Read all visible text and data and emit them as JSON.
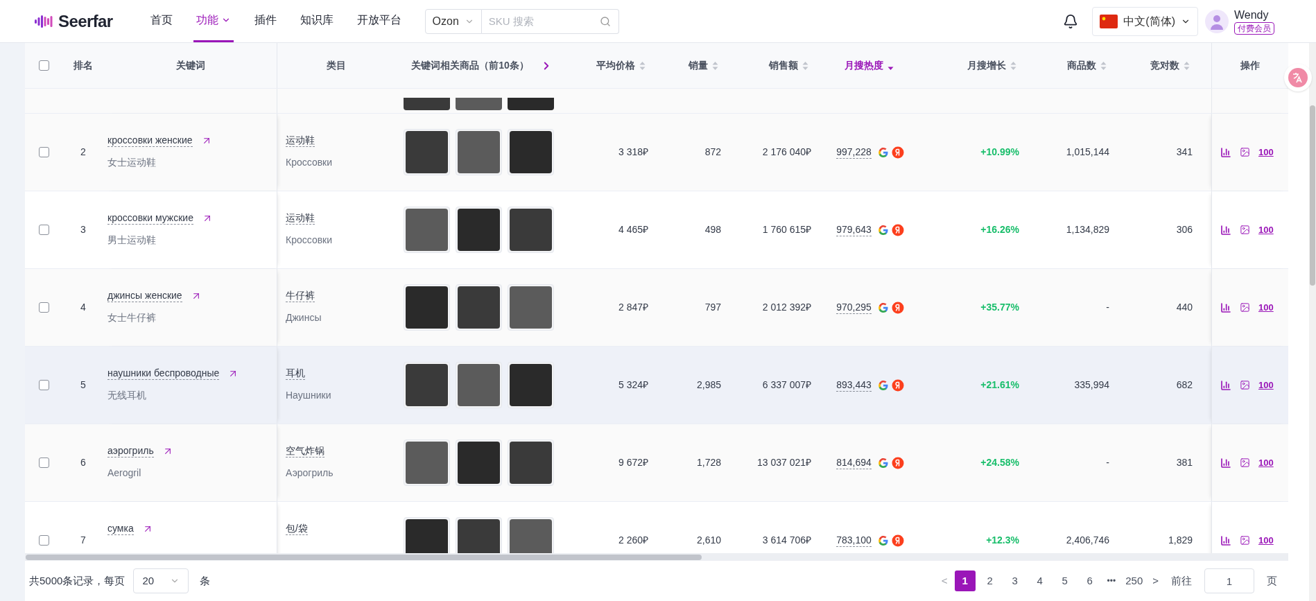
{
  "header": {
    "logo": "Seerfar",
    "nav": [
      {
        "label": "首页",
        "selected": false,
        "dropdown": false
      },
      {
        "label": "功能",
        "selected": true,
        "dropdown": true
      },
      {
        "label": "插件",
        "selected": false,
        "dropdown": false
      },
      {
        "label": "知识库",
        "selected": false,
        "dropdown": false
      },
      {
        "label": "开放平台",
        "selected": false,
        "dropdown": false
      }
    ],
    "platform": "Ozon",
    "search": {
      "placeholder": "SKU 搜索"
    },
    "language": "中文(简体)",
    "user": {
      "name": "Wendy",
      "badge": "付费会员"
    }
  },
  "table": {
    "select_all_checked": false,
    "columns": [
      {
        "label": "排名",
        "sortable": false,
        "sorted_desc": false
      },
      {
        "label": "关键词",
        "sortable": false,
        "sorted_desc": false
      },
      {
        "label": "类目",
        "sortable": false,
        "sorted_desc": false
      },
      {
        "label": "关键词相关商品（前10条）",
        "sortable": false,
        "sorted_desc": false
      },
      {
        "label": "平均价格",
        "sortable": true,
        "sorted_desc": false
      },
      {
        "label": "销量",
        "sortable": true,
        "sorted_desc": false
      },
      {
        "label": "销售额",
        "sortable": true,
        "sorted_desc": false
      },
      {
        "label": "月搜热度",
        "sortable": true,
        "sorted_desc": true
      },
      {
        "label": "月搜增长",
        "sortable": true,
        "sorted_desc": false
      },
      {
        "label": "商品数",
        "sortable": true,
        "sorted_desc": false
      },
      {
        "label": "竞对数",
        "sortable": true,
        "sorted_desc": false
      },
      {
        "label": "操作",
        "sortable": false,
        "sorted_desc": false
      }
    ],
    "rows": [
      {
        "rank": "2",
        "keyword": "кроссовки женские",
        "keyword_zh": "女士运动鞋",
        "category_zh": "运动鞋",
        "category_ru": "Кроссовки",
        "avg_price": "3 318₽",
        "sales": "872",
        "revenue": "2 176 040₽",
        "heat": "997,228",
        "growth": "+10.99%",
        "goods": "1,015,144",
        "competitors": "341",
        "link": "100",
        "checked": false,
        "highlighted": false
      },
      {
        "rank": "3",
        "keyword": "кроссовки мужские",
        "keyword_zh": "男士运动鞋",
        "category_zh": "运动鞋",
        "category_ru": "Кроссовки",
        "avg_price": "4 465₽",
        "sales": "498",
        "revenue": "1 760 615₽",
        "heat": "979,643",
        "growth": "+16.26%",
        "goods": "1,134,829",
        "competitors": "306",
        "link": "100",
        "checked": false,
        "highlighted": false
      },
      {
        "rank": "4",
        "keyword": "джинсы женские",
        "keyword_zh": "女士牛仔裤",
        "category_zh": "牛仔裤",
        "category_ru": "Джинсы",
        "avg_price": "2 847₽",
        "sales": "797",
        "revenue": "2 012 392₽",
        "heat": "970,295",
        "growth": "+35.77%",
        "goods": "-",
        "competitors": "440",
        "link": "100",
        "checked": false,
        "highlighted": false
      },
      {
        "rank": "5",
        "keyword": "наушники беспроводные",
        "keyword_zh": "无线耳机",
        "category_zh": "耳机",
        "category_ru": "Наушники",
        "avg_price": "5 324₽",
        "sales": "2,985",
        "revenue": "6 337 007₽",
        "heat": "893,443",
        "growth": "+21.61%",
        "goods": "335,994",
        "competitors": "682",
        "link": "100",
        "checked": false,
        "highlighted": true
      },
      {
        "rank": "6",
        "keyword": "аэрогриль",
        "keyword_zh": "Aerogril",
        "category_zh": "空气炸锅",
        "category_ru": "Аэрогриль",
        "avg_price": "9 672₽",
        "sales": "1,728",
        "revenue": "13 037 021₽",
        "heat": "814,694",
        "growth": "+24.58%",
        "goods": "-",
        "competitors": "381",
        "link": "100",
        "checked": false,
        "highlighted": false
      },
      {
        "rank": "7",
        "keyword": "сумка",
        "category_zh": "包/袋",
        "avg_price": "2 260₽",
        "sales": "2,610",
        "revenue": "3 614 706₽",
        "heat": "783,100",
        "growth": "+12.3%",
        "goods": "2,406,746",
        "competitors": "1,829",
        "link": "100",
        "checked": false,
        "highlighted": false
      }
    ]
  },
  "footer": {
    "total": "共5000条记录，每页",
    "page_size": "20",
    "unit": "条",
    "prev": "<",
    "pages": [
      {
        "label": "1",
        "selected": true
      },
      {
        "label": "2",
        "selected": false
      },
      {
        "label": "3",
        "selected": false
      },
      {
        "label": "4",
        "selected": false
      },
      {
        "label": "5",
        "selected": false
      },
      {
        "label": "6",
        "selected": false
      }
    ],
    "ellipsis": "•••",
    "last": "250",
    "next": ">",
    "goto": "前往",
    "goto_value": "1",
    "goto_unit": "页"
  }
}
